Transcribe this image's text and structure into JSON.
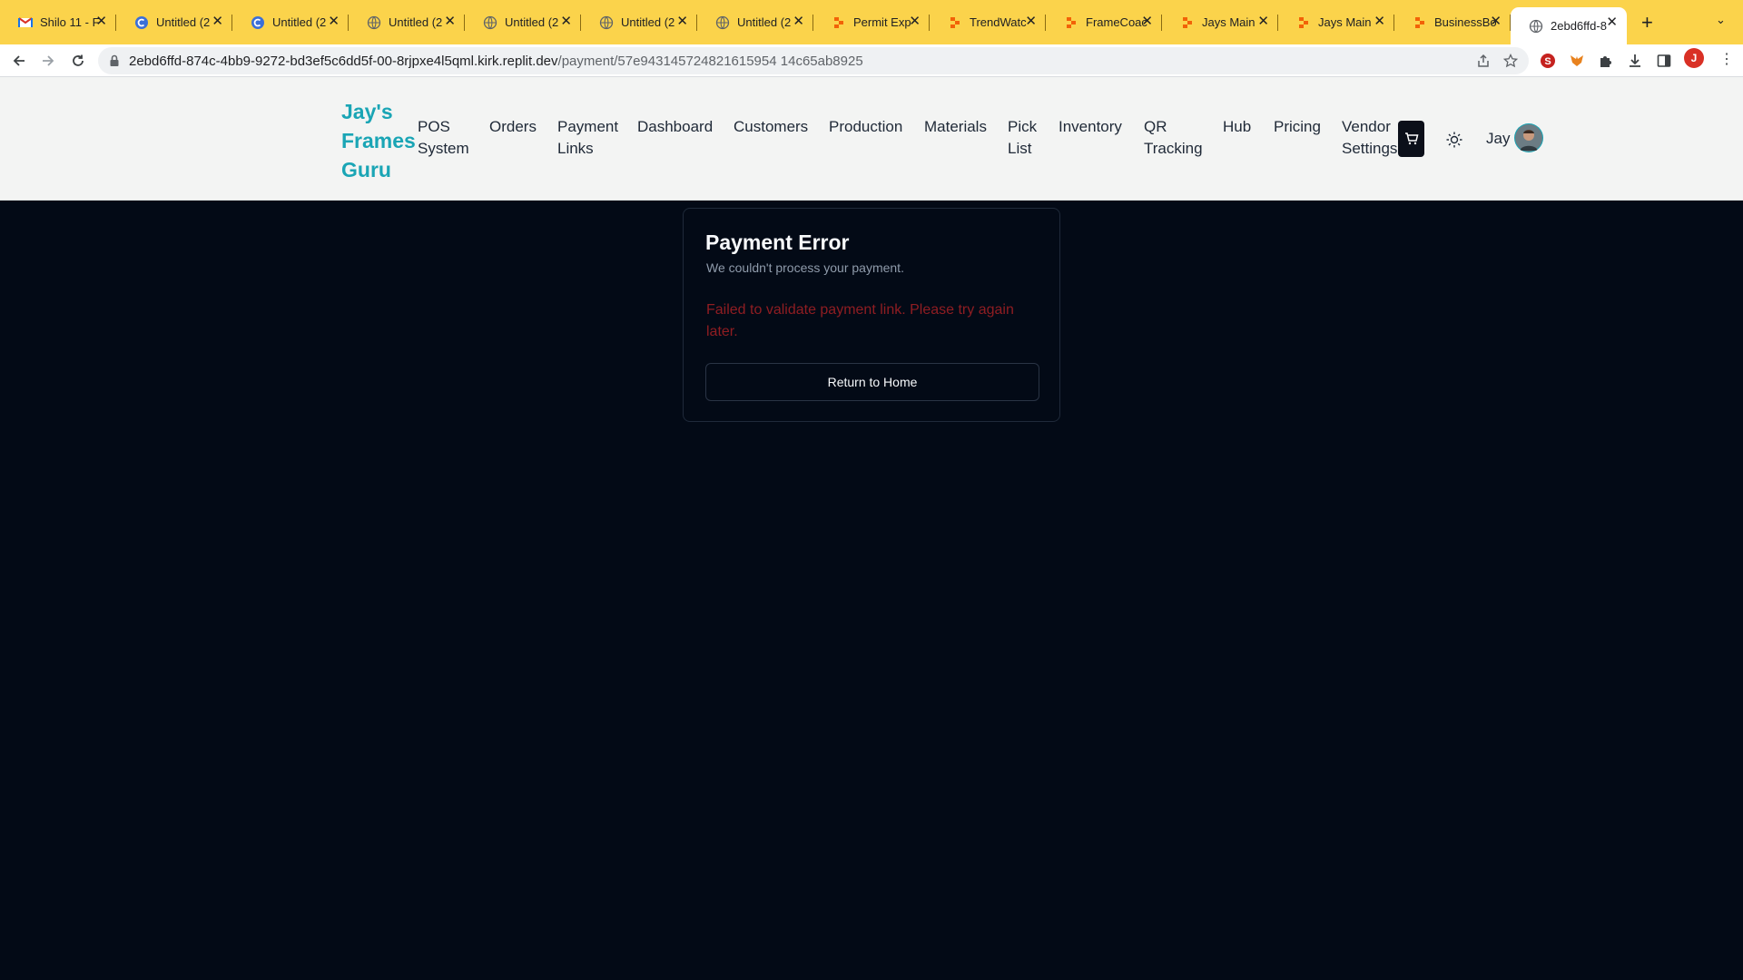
{
  "browser": {
    "tabs": [
      {
        "title": "Shilo 11 - F",
        "icon": "gmail-icon",
        "active": false
      },
      {
        "title": "Untitled (2",
        "icon": "replit-c-icon",
        "active": false
      },
      {
        "title": "Untitled (2",
        "icon": "replit-c-icon",
        "active": false
      },
      {
        "title": "Untitled (2",
        "icon": "globe-icon",
        "active": false
      },
      {
        "title": "Untitled (2",
        "icon": "globe-icon",
        "active": false
      },
      {
        "title": "Untitled (2",
        "icon": "globe-icon",
        "active": false
      },
      {
        "title": "Untitled (2",
        "icon": "globe-icon",
        "active": false
      },
      {
        "title": "Permit Exp",
        "icon": "replit-icon",
        "active": false
      },
      {
        "title": "TrendWatc",
        "icon": "replit-icon",
        "active": false
      },
      {
        "title": "FrameCoac",
        "icon": "replit-icon",
        "active": false
      },
      {
        "title": "Jays Main",
        "icon": "replit-icon",
        "active": false
      },
      {
        "title": "Jays Main",
        "icon": "replit-icon",
        "active": false
      },
      {
        "title": "BusinessBo",
        "icon": "replit-icon",
        "active": false
      },
      {
        "title": "2ebd6ffd-8",
        "icon": "globe-icon",
        "active": true
      }
    ],
    "url_host": "2ebd6ffd-874c-4bb9-9272-bd3ef5c6dd5f-00-8rjpxe4l5qml.kirk.replit.dev",
    "url_path": "/payment/57e943145724821615954 14c65ab8925",
    "profile_initial": "J",
    "tab_bar_color": "#fbd34b"
  },
  "header": {
    "logo": "Jay's Frames Guru",
    "nav": [
      {
        "line1": "POS",
        "line2": "System"
      },
      {
        "line1": "Orders",
        "line2": ""
      },
      {
        "line1": "Payment",
        "line2": "Links"
      },
      {
        "line1": "Dashboard",
        "line2": ""
      },
      {
        "line1": "Customers",
        "line2": ""
      },
      {
        "line1": "Production",
        "line2": ""
      },
      {
        "line1": "Materials",
        "line2": ""
      },
      {
        "line1": "Pick",
        "line2": "List"
      },
      {
        "line1": "Inventory",
        "line2": ""
      },
      {
        "line1": "QR",
        "line2": "Tracking"
      },
      {
        "line1": "Hub",
        "line2": ""
      },
      {
        "line1": "Pricing",
        "line2": ""
      },
      {
        "line1": "Vendor",
        "line2": "Settings"
      }
    ],
    "user_name": "Jay",
    "brand_color": "#1aa5b5"
  },
  "card": {
    "title": "Payment Error",
    "subtitle": "We couldn't process your payment.",
    "error": "Failed to validate payment link. Please try again later.",
    "button": "Return to Home",
    "error_color": "#8f1d22"
  }
}
